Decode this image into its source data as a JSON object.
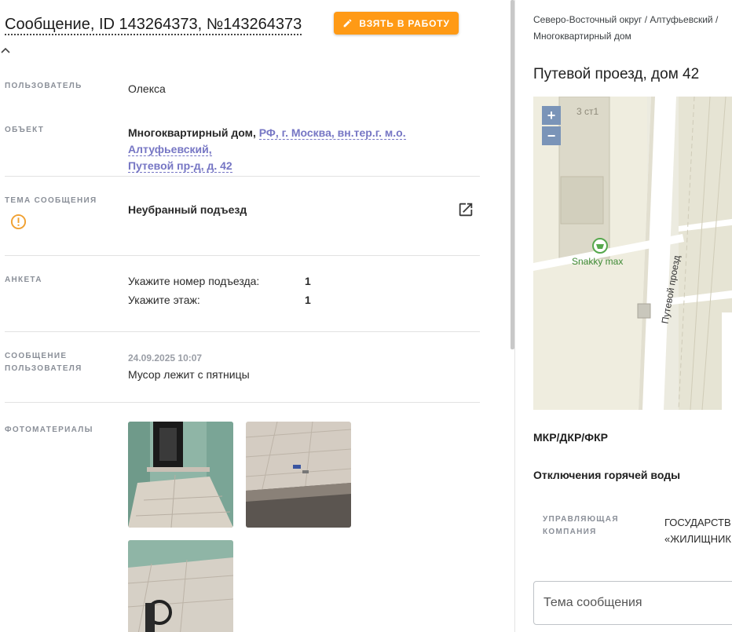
{
  "header": {
    "title": "Сообщение, ID 143264373, №143264373",
    "take_button": "ВЗЯТЬ В РАБОТУ"
  },
  "fields": {
    "user": {
      "label": "ПОЛЬЗОВАТЕЛЬ",
      "value": "Олекса"
    },
    "object": {
      "label": "ОБЪЕКТ",
      "type": "Многоквартирный дом,",
      "address_line1": "РФ, г. Москва, вн.тер.г. м.о. Алтуфьевский,",
      "address_line2": "Путевой пр-д, д. 42"
    },
    "topic": {
      "label": "ТЕМА СООБЩЕНИЯ",
      "value": "Неубранный подъезд"
    },
    "anketa": {
      "label": "АНКЕТА",
      "rows": [
        {
          "q": "Укажите номер подъезда:",
          "a": "1"
        },
        {
          "q": "Укажите этаж:",
          "a": "1"
        }
      ]
    },
    "message": {
      "label_line1": "СООБЩЕНИЕ",
      "label_line2": "ПОЛЬЗОВАТЕЛЯ",
      "timestamp": "24.09.2025 10:07",
      "text": "Мусор лежит с пятницы"
    },
    "photos": {
      "label": "ФОТОМАТЕРИАЛЫ",
      "count": 3
    }
  },
  "side": {
    "breadcrumb_line1": "Северо-Восточный округ / Алтуфьевский /",
    "breadcrumb_line2": "Многоквартирный дом",
    "address": "Путевой проезд, дом 42",
    "map": {
      "zoom_in": "+",
      "zoom_out": "−",
      "building_label": "3 ст1",
      "poi_label": "Snakky max",
      "street_label": "Путевой проезд"
    },
    "section_repairs": "МКР/ДКР/ФКР",
    "section_hot_water": "Отключения горячей воды",
    "management": {
      "label_line1": "УПРАВЛЯЮЩАЯ",
      "label_line2": "КОМПАНИЯ",
      "value_line1": "ГОСУДАРСТВ",
      "value_line2": "«ЖИЛИЩНИК"
    },
    "topic_input_placeholder": "Тема сообщения"
  },
  "colors": {
    "accent": "#ff9a15",
    "link": "#7676c4",
    "warning": "#f0a030",
    "label": "#8a8f98"
  }
}
